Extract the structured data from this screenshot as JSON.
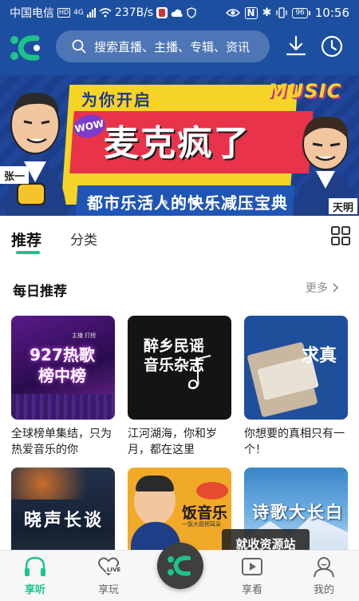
{
  "status_bar": {
    "carrier": "中国电信",
    "network_badge": "HD",
    "network_type": "4G",
    "speed": "237B/s",
    "battery": "96",
    "time": "10:56"
  },
  "app_bar": {
    "search_placeholder": "搜索直播、主播、专辑、资讯"
  },
  "banner": {
    "tag": "为你开启",
    "badge": "WOW",
    "title": "麦克疯了",
    "subtitle": "都市乐活人的快乐减压宝典",
    "music_text": "MUSIC",
    "left_name": "张一",
    "right_name": "天明",
    "page_count": 5,
    "active_page": 4
  },
  "tabs": {
    "recommend": "推荐",
    "category": "分类"
  },
  "daily": {
    "title": "每日推荐",
    "more": "更多",
    "items": [
      {
        "cover_text": "927热歌榜中榜",
        "cover_small": "主播  打榜",
        "desc": "全球榜单集结，只为热爱音乐的你"
      },
      {
        "cover_text": "醉乡民谣音乐杂志",
        "desc": "江河湖海，你和岁月，都在这里"
      },
      {
        "cover_text": "求真",
        "desc": "你想要的真相只有一个！"
      },
      {
        "cover_text": "晓声长谈",
        "desc": ""
      },
      {
        "cover_text": "饭音乐",
        "cover_small": "一饭大厨把耳朵",
        "desc": ""
      },
      {
        "cover_text": "诗歌大长白",
        "desc": ""
      }
    ]
  },
  "bottom_nav": {
    "listen": "享听",
    "play": "享玩",
    "watch": "享看",
    "mine": "我的",
    "live_badge": "LIVE"
  },
  "watermark": "就收资源站",
  "colors": {
    "header_blue": "#1d4fa0",
    "accent_green": "#1ec28b",
    "banner_yellow": "#f5d426",
    "banner_red": "#e8334a"
  }
}
